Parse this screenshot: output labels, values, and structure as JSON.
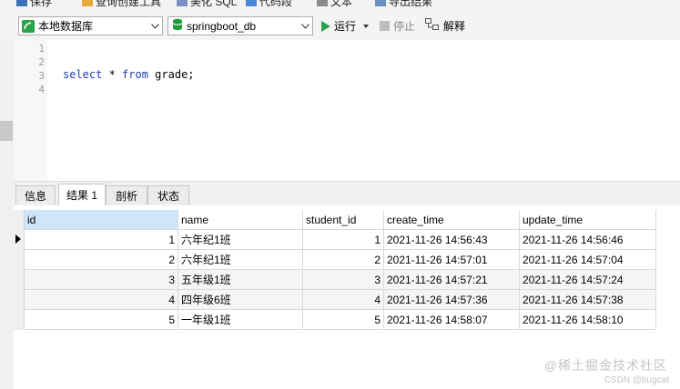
{
  "top_toolbar": {
    "items": [
      "保存",
      "查询创建工具",
      "美化 SQL",
      "代码段",
      "文本",
      "导出结果"
    ]
  },
  "conn_toolbar": {
    "connection": "本地数据库",
    "database": "springboot_db",
    "run_label": "运行",
    "stop_label": "停止",
    "explain_label": "解释"
  },
  "editor": {
    "line_numbers": [
      "1",
      "2",
      "3",
      "4"
    ],
    "sql_kw1": "select",
    "sql_mid": " * ",
    "sql_kw2": "from",
    "sql_rest": " grade;"
  },
  "result_tabs": [
    "信息",
    "结果 1",
    "剖析",
    "状态"
  ],
  "grid": {
    "columns": [
      "id",
      "name",
      "student_id",
      "create_time",
      "update_time"
    ],
    "rows": [
      [
        "1",
        "六年纪1班",
        "1",
        "2021-11-26 14:56:43",
        "2021-11-26 14:56:46"
      ],
      [
        "2",
        "六年纪1班",
        "2",
        "2021-11-26 14:57:01",
        "2021-11-26 14:57:04"
      ],
      [
        "3",
        "五年级1班",
        "3",
        "2021-11-26 14:57:21",
        "2021-11-26 14:57:24"
      ],
      [
        "4",
        "四年级6班",
        "4",
        "2021-11-26 14:57:36",
        "2021-11-26 14:57:38"
      ],
      [
        "5",
        "一年级1班",
        "5",
        "2021-11-26 14:58:07",
        "2021-11-26 14:58:10"
      ]
    ]
  },
  "watermark": {
    "line1": "@稀土掘金技术社区",
    "line2": "CSDN @bugcat"
  },
  "colors": {
    "header_selected": "#cfe5f9",
    "run_green": "#2aa24a",
    "db_green": "#1e9e3a",
    "keyword_blue": "#1f3fb0"
  }
}
